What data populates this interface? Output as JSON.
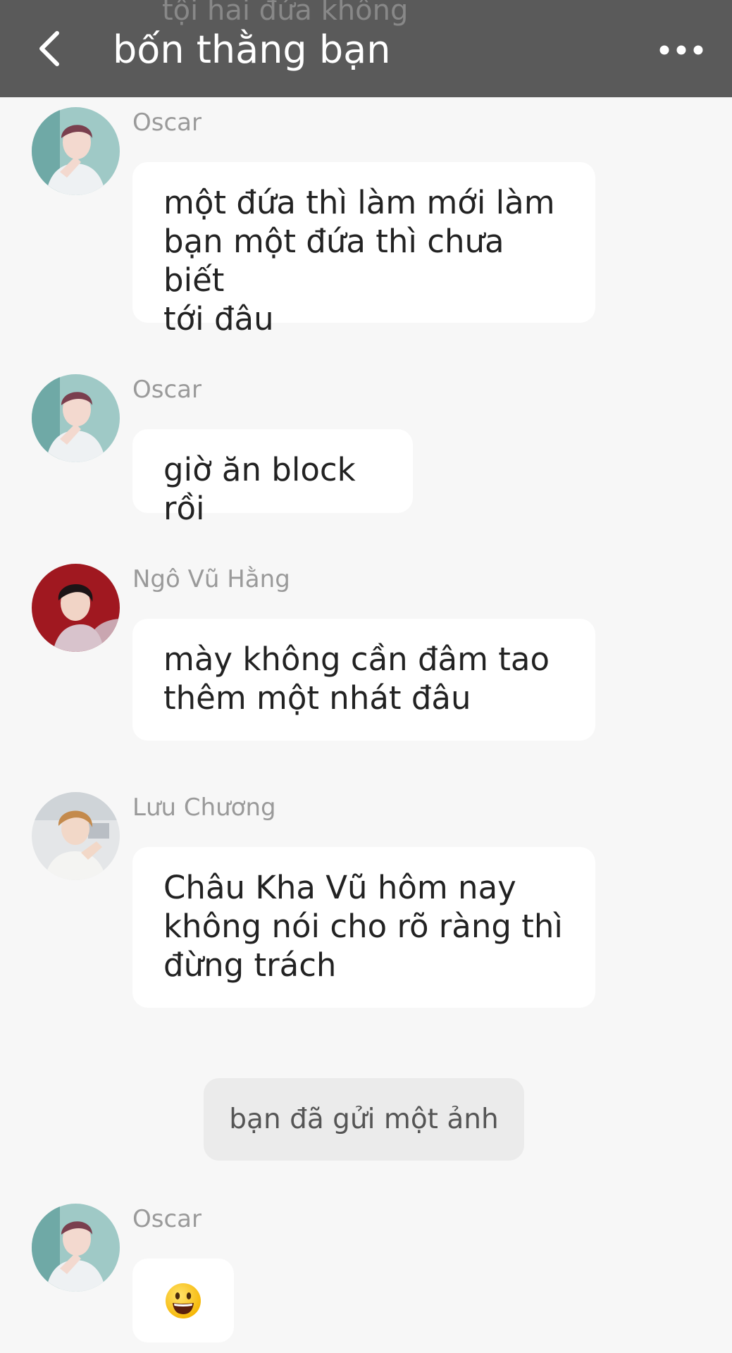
{
  "header": {
    "title": "bốn thằng bạn",
    "scrolled_preview_text": "tội hai đứa không"
  },
  "messages": [
    {
      "sender": "Oscar",
      "text": "một đứa thì làm mới làm\nbạn một đứa thì chưa biết\ntới đâu",
      "avatar": "oscar-avatar"
    },
    {
      "sender": "Oscar",
      "text": "giờ ăn block rồi",
      "avatar": "oscar-avatar"
    },
    {
      "sender": "Ngô Vũ Hằng",
      "text": "mày không cần đâm tao\nthêm một nhát đâu",
      "avatar": "ngo-vu-hang-avatar"
    },
    {
      "sender": "Lưu Chương",
      "text": "Châu Kha Vũ hôm nay\nkhông nói cho rõ ràng thì\nđừng trách",
      "avatar": "luu-chuong-avatar"
    },
    {
      "sender": "Oscar",
      "text": "",
      "emoji": "smiley-emoji-icon",
      "avatar": "oscar-avatar"
    }
  ],
  "system_notice": "bạn đã gửi một ảnh",
  "colors": {
    "header_bg": "#5a5a5a",
    "page_bg": "#f7f7f7",
    "bubble_bg": "#ffffff",
    "notice_bg": "#ebebeb",
    "sender_text": "#9a9a9a",
    "message_text": "#222222"
  },
  "icons": {
    "back": "chevron-left-icon",
    "more": "more-dots-icon"
  }
}
